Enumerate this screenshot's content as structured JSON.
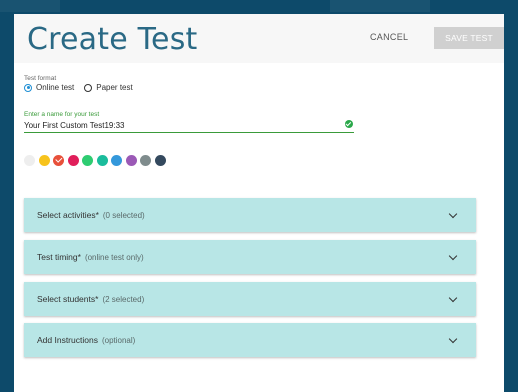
{
  "header": {
    "title": "Create Test",
    "cancel_label": "CANCEL",
    "save_label": "SAVE TEST"
  },
  "format": {
    "label": "Test format",
    "options": [
      {
        "label": "Online test",
        "selected": true
      },
      {
        "label": "Paper test",
        "selected": false
      }
    ]
  },
  "name": {
    "label": "Enter a name for your test",
    "value": "Your First Custom Test19:33"
  },
  "colors": [
    {
      "hex": "#eeeeee",
      "selected": false
    },
    {
      "hex": "#f7c31c",
      "selected": false
    },
    {
      "hex": "#e8503a",
      "selected": true
    },
    {
      "hex": "#e01e5a",
      "selected": false
    },
    {
      "hex": "#2ecc71",
      "selected": false
    },
    {
      "hex": "#1abc9c",
      "selected": false
    },
    {
      "hex": "#3498db",
      "selected": false
    },
    {
      "hex": "#9b59b6",
      "selected": false
    },
    {
      "hex": "#7f8c8d",
      "selected": false
    },
    {
      "hex": "#34495e",
      "selected": false
    }
  ],
  "sections": [
    {
      "title": "Select activities*",
      "sub": "(0 selected)"
    },
    {
      "title": "Test timing*",
      "sub": "(online test only)"
    },
    {
      "title": "Select students*",
      "sub": "(2 selected)"
    },
    {
      "title": "Add Instructions",
      "sub": "(optional)"
    }
  ]
}
